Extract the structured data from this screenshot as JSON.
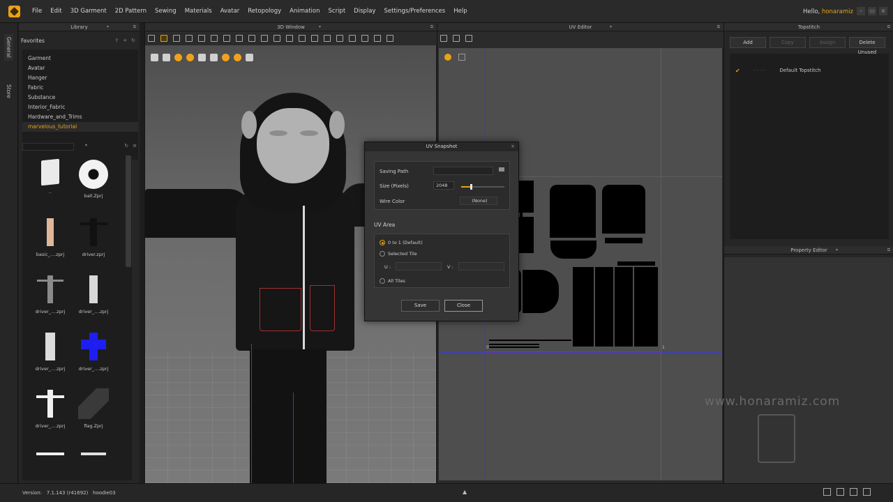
{
  "menubar": {
    "items": [
      "File",
      "Edit",
      "3D Garment",
      "2D Pattern",
      "Sewing",
      "Materials",
      "Avatar",
      "Retopology",
      "Animation",
      "Script",
      "Display",
      "Settings/Preferences",
      "Help"
    ],
    "greeting": "Hello,",
    "username": "honaramiz",
    "window_controls": [
      "–",
      "▭",
      "×"
    ]
  },
  "side_tabs": [
    "General",
    "Store"
  ],
  "library": {
    "title": "Library",
    "favorites_label": "Favorites",
    "favorites": [
      "Garment",
      "Avatar",
      "Hanger",
      "Fabric",
      "Substance",
      "Interior_Fabric",
      "Hardware_and_Trims",
      "marvelous_tutorial"
    ],
    "active_favorite": "marvelous_tutorial",
    "files": [
      "..",
      "ball.Zprj",
      "basic_....zprj",
      "driver.zprj",
      "driver_....zprj",
      "driver_....zprj",
      "driver_....zprj",
      "driver_....zprj",
      "driver_....zprj",
      "flag.Zprj"
    ]
  },
  "window3d": {
    "title": "3D Window"
  },
  "uv_editor": {
    "title": "UV Editor",
    "tick_zero": "0",
    "tick_one": "1"
  },
  "topstitch": {
    "title": "Topstitch",
    "buttons": [
      "Add",
      "Copy",
      "Assign",
      "Delete Unused"
    ],
    "default_item": "Default Topstitch"
  },
  "property_editor": {
    "title": "Property Editor"
  },
  "dialog": {
    "title": "UV Snapshot",
    "saving_path_label": "Saving Path",
    "saving_path_value": "",
    "size_label": "Size (Pixels)",
    "size_value": "2048",
    "size_fraction": 0.22,
    "wire_color_label": "Wire Color",
    "wire_color_value": "(None)",
    "uv_area_label": "UV Area",
    "options": [
      "0 to 1 (Default)",
      "Selected Tile",
      "All Tiles"
    ],
    "selected_option": "0 to 1 (Default)",
    "u_label": "U :",
    "v_label": "V :",
    "save_label": "Save",
    "close_label": "Close"
  },
  "watermark": "www.honaramiz.com",
  "status": {
    "version_label": "Version:",
    "version": "7.1.143 (r41692)",
    "project": "hoodie03"
  },
  "colors": {
    "accent": "#e8a317",
    "uv_tile_axis": "#3a3ad0",
    "seam_red": "#b03030"
  }
}
